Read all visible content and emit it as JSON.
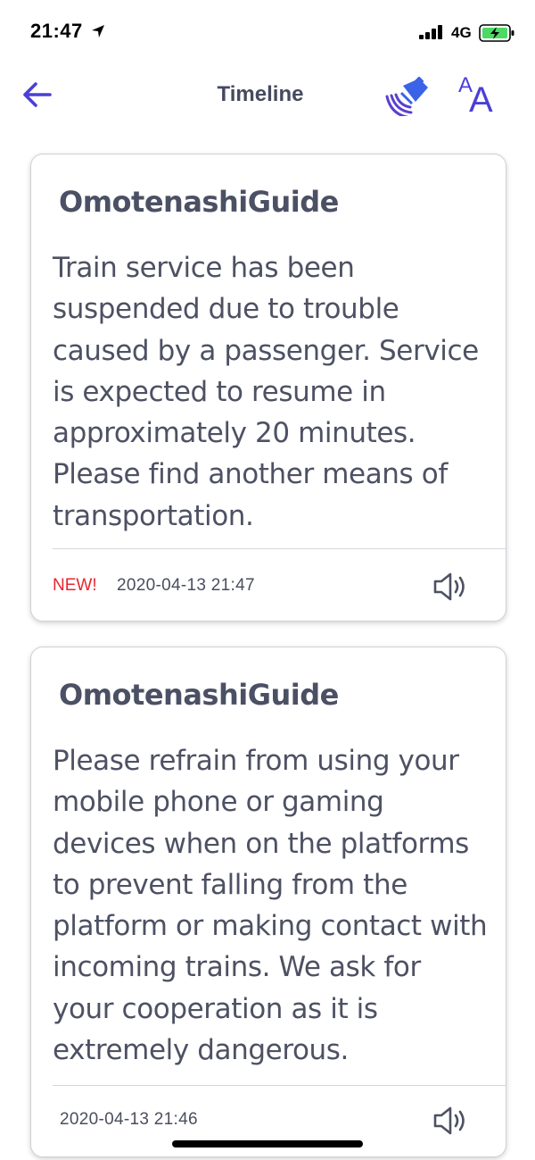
{
  "status_bar": {
    "time": "21:47",
    "network": "4G",
    "icons": [
      "location-arrow-icon",
      "signal-bars-icon",
      "battery-charging-icon"
    ]
  },
  "nav": {
    "title": "Timeline",
    "icons": [
      "back-arrow-icon",
      "voice-announcement-icon",
      "font-size-icon"
    ],
    "font_size_small": "A",
    "font_size_large": "A",
    "accent_color": "#4a3fd6"
  },
  "timeline": [
    {
      "sender": "OmotenashiGuide",
      "body": "Train service has been suspended due to trouble caused by a passenger. Service is expected to resume in approximately 20 minutes. Please find another means of transportation.",
      "badge": "NEW!",
      "timestamp": "2020-04-13 21:47",
      "icon": "speaker-icon"
    },
    {
      "sender": "OmotenashiGuide",
      "body": "Please refrain from using your mobile phone or gaming devices when on the platforms to prevent falling from the platform or making contact with incoming trains. We ask for your cooperation as it is extremely dangerous.",
      "timestamp": "2020-04-13 21:46",
      "icon": "speaker-icon"
    }
  ],
  "colors": {
    "badge_new": "#e8262f",
    "text": "#4d5163"
  }
}
